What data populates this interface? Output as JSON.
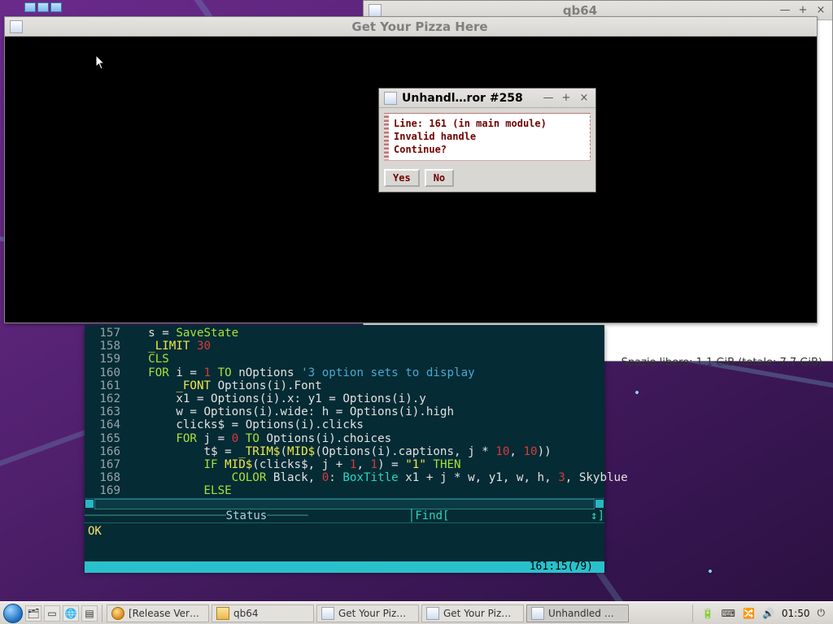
{
  "qb64_window": {
    "title": "qb64"
  },
  "pizza_window": {
    "title": "Get Your Pizza Here"
  },
  "error_dialog": {
    "title": "Unhandl…ror #258",
    "line1": "Line: 161 (in main module)",
    "line2": "Invalid handle",
    "line3": "Continue?",
    "yes": "Yes",
    "no": "No"
  },
  "disk_status": "Spazio libero: 1,1 GiB (totale: 7,7 GiB)",
  "editor": {
    "status_left": "Status",
    "find_label": "Find[",
    "find_end": "↕]",
    "ok": "OK",
    "cursor_pos": "161:15(79)",
    "lines": {
      "l157": {
        "n": "157",
        "a": "s = ",
        "b": "SaveState"
      },
      "l158": {
        "n": "158",
        "a": "_LIMIT ",
        "b": "30"
      },
      "l159": {
        "n": "159",
        "a": "CLS"
      },
      "l160": {
        "n": "160",
        "a": "FOR",
        "b": " i = ",
        "c": "1",
        "d": " TO",
        "e": " nOptions ",
        "f": "'3 option sets to display"
      },
      "l161": {
        "n": "161",
        "a": "_FONT",
        "b": " Options(i).Font"
      },
      "l162": {
        "n": "162",
        "a": "x1 = Options(i).x: y1 = Options(i).y"
      },
      "l163": {
        "n": "163",
        "a": "w = Options(i).wide: h = Options(i).high"
      },
      "l164": {
        "n": "164",
        "a": "clicks$ = Options(i).clicks"
      },
      "l165": {
        "n": "165",
        "a": "FOR",
        "b": " j = ",
        "c": "0",
        "d": " TO",
        "e": " Options(i).choices"
      },
      "l166": {
        "n": "166",
        "a": "t$ = ",
        "b": "_TRIM$",
        "c": "(",
        "d": "MID$",
        "e": "(Options(i).captions, j * ",
        "f": "10",
        "g": ", ",
        "h": "10",
        "i": "))"
      },
      "l167": {
        "n": "167",
        "a": "IF ",
        "b": "MID$",
        "c": "(clicks$, j + ",
        "d": "1",
        "e": ", ",
        "f": "1",
        "g": ") = ",
        "h": "\"1\"",
        "i": " THEN"
      },
      "l168": {
        "n": "168",
        "a": "COLOR",
        "b": " Black, ",
        "c": "0",
        "d": ": ",
        "e": "BoxTitle",
        "f": " x1 + j * w, y1, w, h, ",
        "g": "3",
        "h": ", Skyblue"
      },
      "l169": {
        "n": "169",
        "a": "ELSE"
      }
    }
  },
  "taskbar": {
    "items": [
      {
        "label": "[Release Ver…",
        "kind": "globe"
      },
      {
        "label": "qb64",
        "kind": "folder"
      },
      {
        "label": "Get Your Piz…",
        "kind": "win"
      },
      {
        "label": "Get Your Piz…",
        "kind": "win"
      },
      {
        "label": "Unhandled …",
        "kind": "win",
        "active": true
      }
    ],
    "time": "01:50"
  }
}
